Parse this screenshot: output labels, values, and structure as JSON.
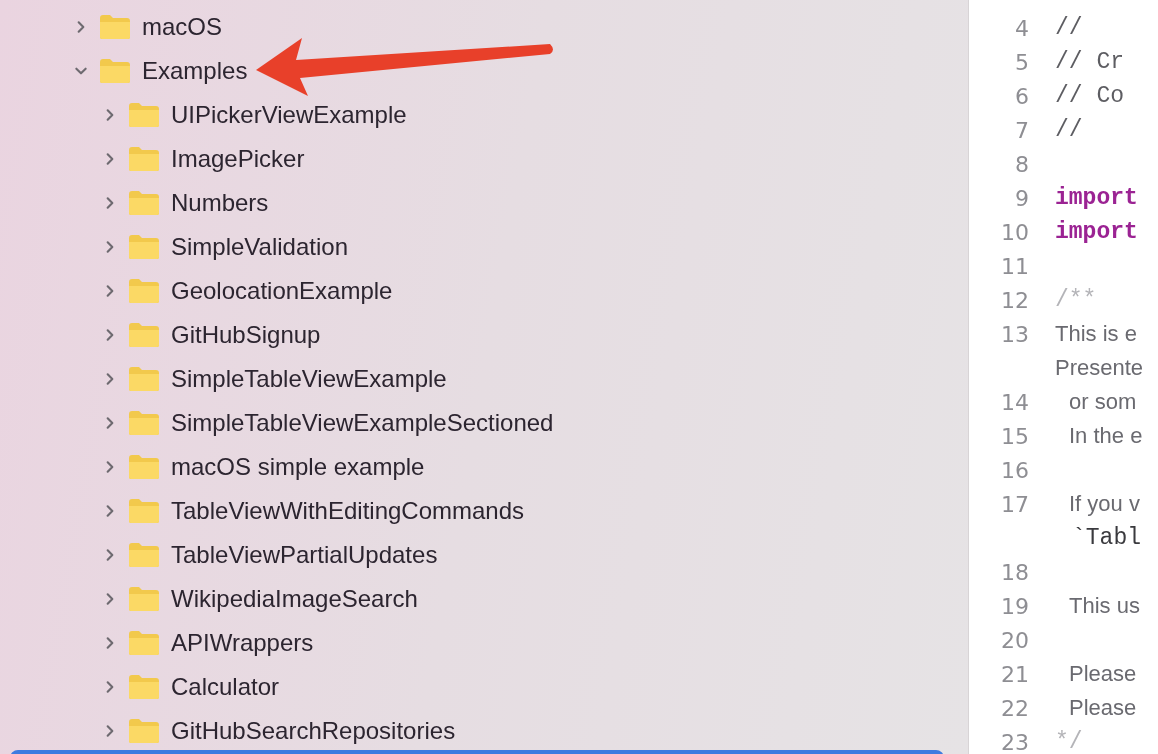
{
  "tree": [
    {
      "label": "macOS",
      "expanded": false
    },
    {
      "label": "Examples",
      "expanded": true,
      "children": [
        {
          "label": "UIPickerViewExample",
          "expanded": false
        },
        {
          "label": "ImagePicker",
          "expanded": false
        },
        {
          "label": "Numbers",
          "expanded": false
        },
        {
          "label": "SimpleValidation",
          "expanded": false
        },
        {
          "label": "GeolocationExample",
          "expanded": false
        },
        {
          "label": "GitHubSignup",
          "expanded": false
        },
        {
          "label": "SimpleTableViewExample",
          "expanded": false
        },
        {
          "label": "SimpleTableViewExampleSectioned",
          "expanded": false
        },
        {
          "label": "macOS simple example",
          "expanded": false
        },
        {
          "label": "TableViewWithEditingCommands",
          "expanded": false
        },
        {
          "label": "TableViewPartialUpdates",
          "expanded": false
        },
        {
          "label": "WikipediaImageSearch",
          "expanded": false
        },
        {
          "label": "APIWrappers",
          "expanded": false
        },
        {
          "label": "Calculator",
          "expanded": false
        },
        {
          "label": "GitHubSearchRepositories",
          "expanded": false
        }
      ]
    }
  ],
  "code_lines": [
    {
      "number": "4",
      "kind": "comment",
      "text": "//"
    },
    {
      "number": "5",
      "kind": "comment",
      "text": "//  Cr"
    },
    {
      "number": "6",
      "kind": "comment",
      "text": "//  Co"
    },
    {
      "number": "7",
      "kind": "comment",
      "text": "//"
    },
    {
      "number": "8"
    },
    {
      "number": "9",
      "kind": "keyword",
      "text": "import"
    },
    {
      "number": "10",
      "kind": "keyword",
      "text": "import"
    },
    {
      "number": "11"
    },
    {
      "number": "12",
      "kind": "doc-mark",
      "text": "/**"
    },
    {
      "number": "13",
      "kind": "doc",
      "text": "This is e"
    },
    {
      "kind": "doc",
      "text": "Presente"
    },
    {
      "number": "14",
      "kind": "doc-indent",
      "text": "or som"
    },
    {
      "number": "15",
      "kind": "doc-indent",
      "text": "In the e"
    },
    {
      "number": "16"
    },
    {
      "number": "17",
      "kind": "doc-indent",
      "text": "If you v"
    },
    {
      "kind": "mono-indent",
      "text": "`Tabl"
    },
    {
      "number": "18"
    },
    {
      "number": "19",
      "kind": "doc-indent",
      "text": "This us"
    },
    {
      "number": "20"
    },
    {
      "number": "21",
      "kind": "doc-indent",
      "text": "Please"
    },
    {
      "number": "22",
      "kind": "doc-indent",
      "text": "Please"
    },
    {
      "number": "23",
      "kind": "doc-mark",
      "text": "*/"
    }
  ]
}
